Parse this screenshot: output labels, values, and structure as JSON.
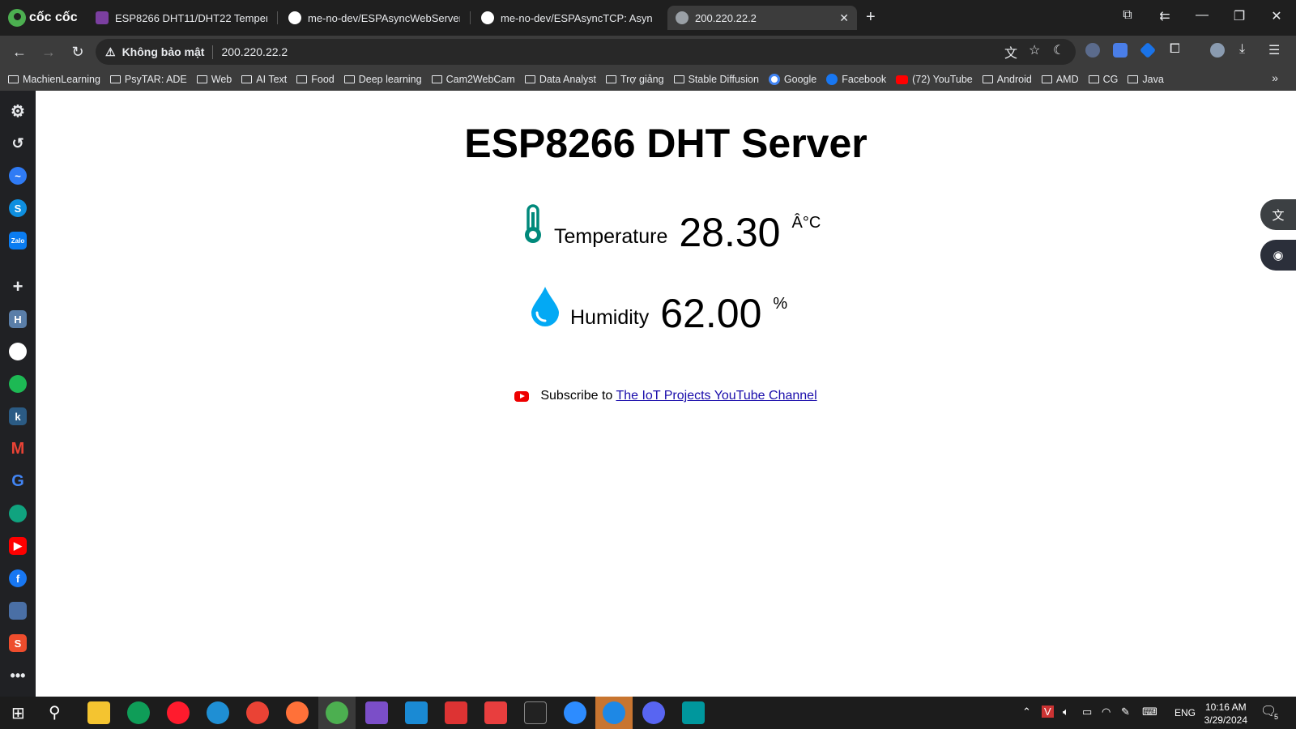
{
  "browser": {
    "brand": "cốc cốc",
    "tabs": [
      {
        "label": "ESP8266 DHT11/DHT22 Temperat",
        "active": false
      },
      {
        "label": "me-no-dev/ESPAsyncWebServer: /",
        "active": false
      },
      {
        "label": "me-no-dev/ESPAsyncTCP: Async T",
        "active": false
      },
      {
        "label": "200.220.22.2",
        "active": true
      }
    ],
    "security_label": "Không bảo mật",
    "url": "200.220.22.2",
    "bookmarks": [
      "MachienLearning",
      "PsyTAR: ADE",
      "Web",
      "AI Text",
      "Food",
      "Deep learning",
      "Cam2WebCam",
      "Data Analyst",
      "Trợ giảng",
      "Stable Diffusion",
      "Google",
      "Facebook",
      "(72) YouTube",
      "Android",
      "AMD",
      "CG",
      "Java"
    ]
  },
  "page": {
    "title": "ESP8266 DHT Server",
    "temperature": {
      "label": "Temperature",
      "value": "28.30",
      "unit": "Â°C"
    },
    "humidity": {
      "label": "Humidity",
      "value": "62.00",
      "unit": "%"
    },
    "subscribe_text": "Subscribe to",
    "subscribe_link": "The IoT Projects YouTube Channel"
  },
  "taskbar": {
    "language": "ENG",
    "time": "10:16 AM",
    "date": "3/29/2024",
    "notification_count": "5"
  },
  "colors": {
    "thermometer": "#00897b",
    "droplet": "#03a9f4",
    "youtube": "#ff0000",
    "link": "#1a0dab"
  }
}
